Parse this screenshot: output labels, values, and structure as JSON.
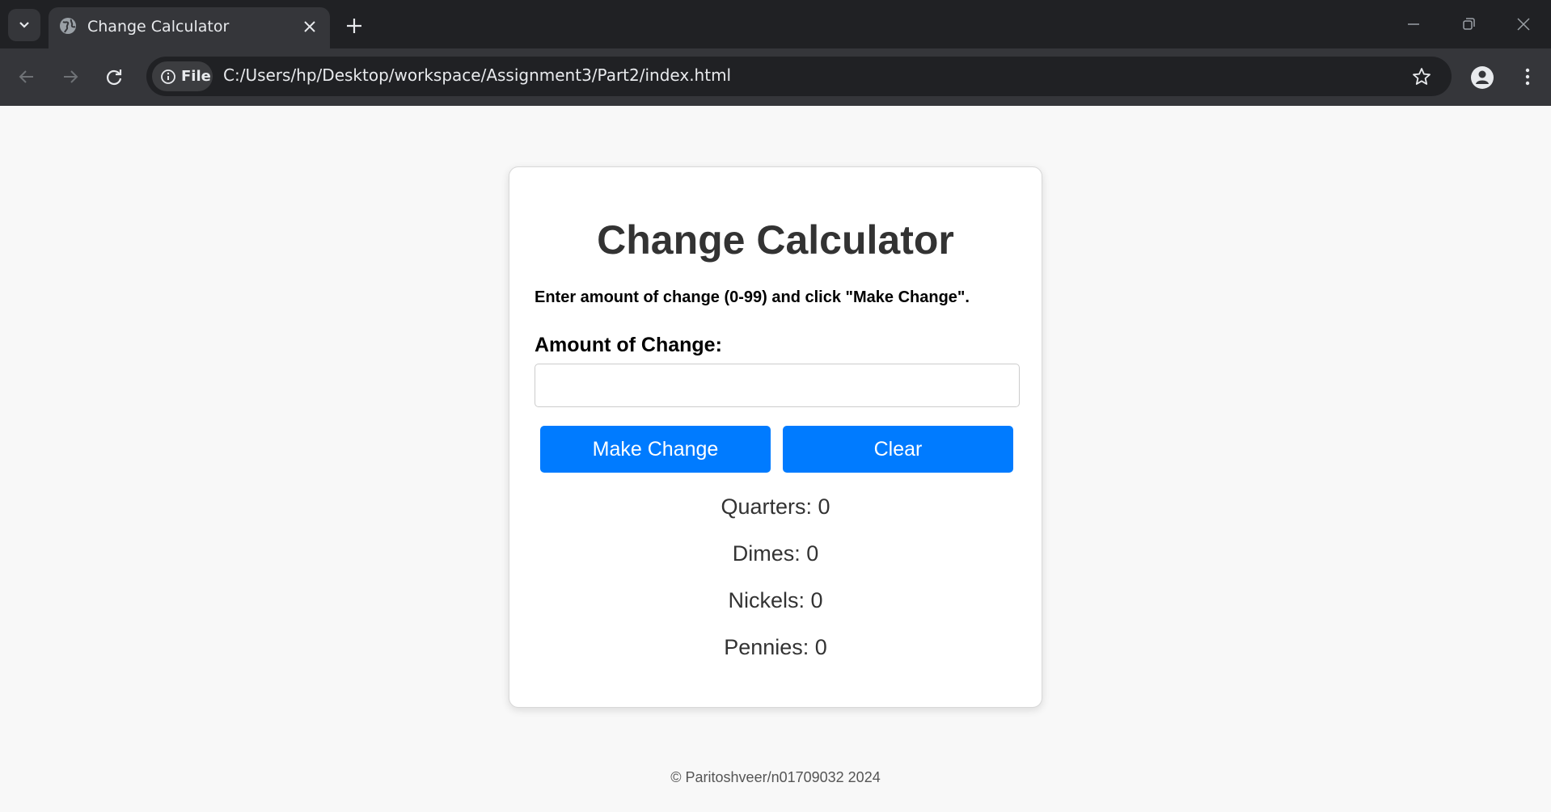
{
  "browser": {
    "tab_title": "Change Calculator",
    "site_chip_label": "File",
    "url": "C:/Users/hp/Desktop/workspace/Assignment3/Part2/index.html",
    "icons": [
      "tab-list-icon",
      "globe-icon",
      "close-icon",
      "plus-icon",
      "minimize-icon",
      "restore-icon",
      "window-close-icon",
      "back-arrow-icon",
      "forward-arrow-icon",
      "reload-icon",
      "info-icon",
      "star-icon",
      "profile-icon",
      "more-vert-icon"
    ]
  },
  "page": {
    "title": "Change Calculator",
    "instructions": "Enter amount of change (0-99) and click \"Make Change\".",
    "amount_label": "Amount of Change:",
    "amount_value": "",
    "make_change_label": "Make Change",
    "clear_label": "Clear",
    "results": {
      "quarters": "Quarters: 0",
      "dimes": "Dimes: 0",
      "nickels": "Nickels: 0",
      "pennies": "Pennies: 0"
    },
    "footer": "© Paritoshveer/n01709032 2024"
  },
  "colors": {
    "button": "#007bff",
    "chrome_dark": "#202124",
    "chrome_toolbar": "#35363a",
    "page_bg": "#f8f8f8"
  }
}
